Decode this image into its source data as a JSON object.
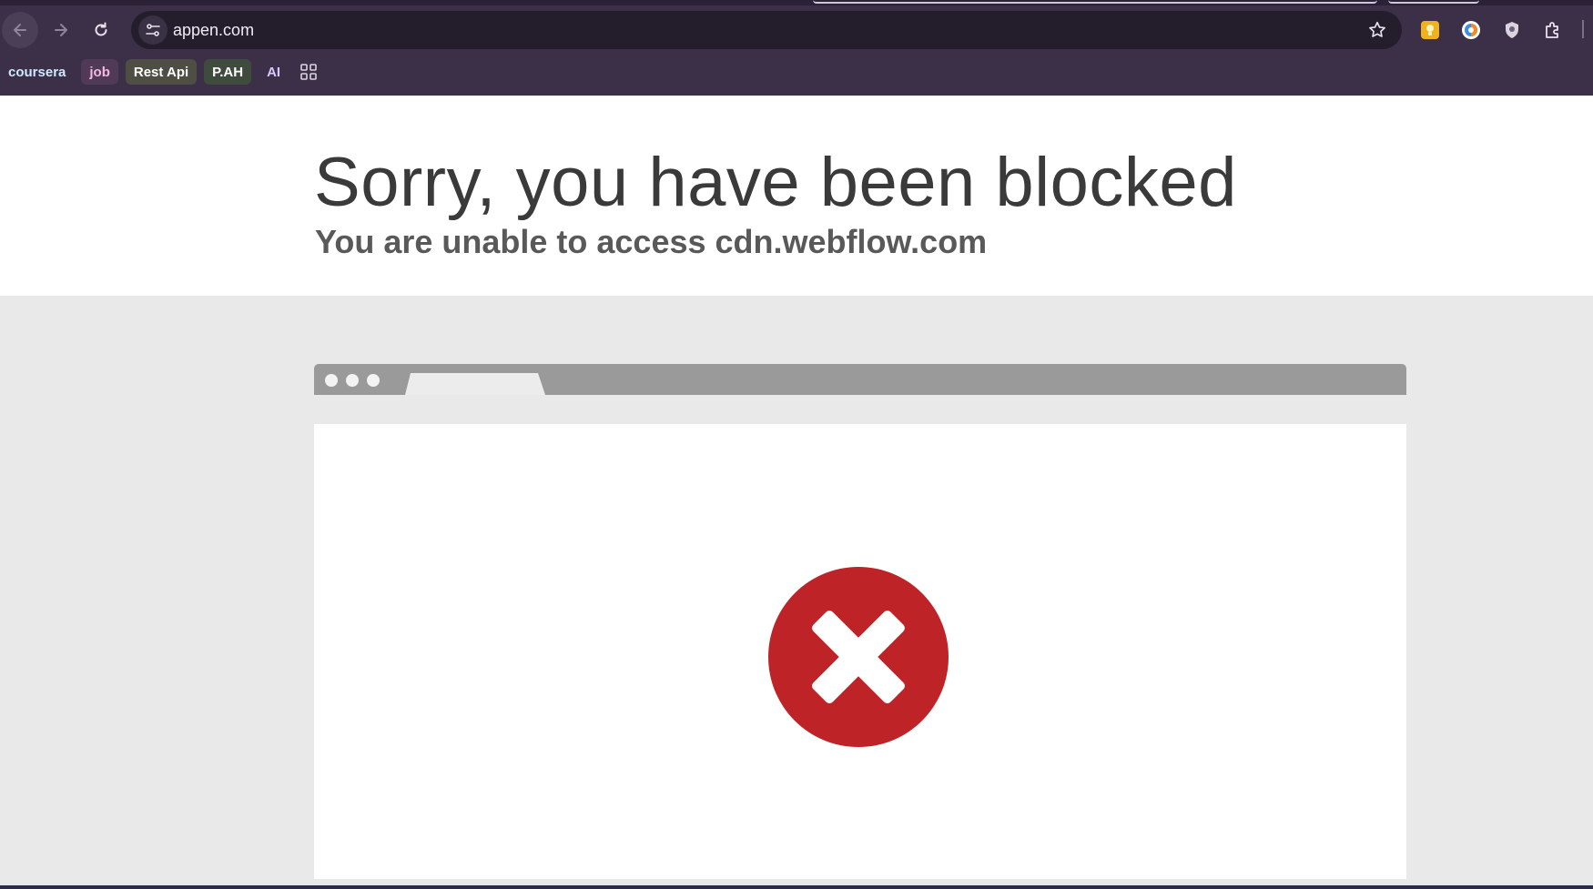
{
  "browser": {
    "url": "appen.com",
    "bookmarks": [
      {
        "label": "coursera"
      },
      {
        "label": "job"
      },
      {
        "label": "Rest Api"
      },
      {
        "label": "P.AH"
      },
      {
        "label": "AI"
      }
    ],
    "icons": {
      "back": "arrow-left-icon",
      "forward": "arrow-right-icon",
      "reload": "reload-icon",
      "site_info": "tune-icon",
      "bookmark_star": "star-icon",
      "apps": "grid-icon",
      "extensions": [
        "yellow-extension-icon",
        "blue-circle-extension-icon",
        "shield-extension-icon",
        "puzzle-icon"
      ]
    }
  },
  "page": {
    "headline": "Sorry, you have been blocked",
    "subline": "You are unable to access cdn.webflow.com"
  },
  "colors": {
    "chrome": "#3b3048",
    "error_red": "#be2327",
    "page_bg": "#e9e9e9"
  }
}
